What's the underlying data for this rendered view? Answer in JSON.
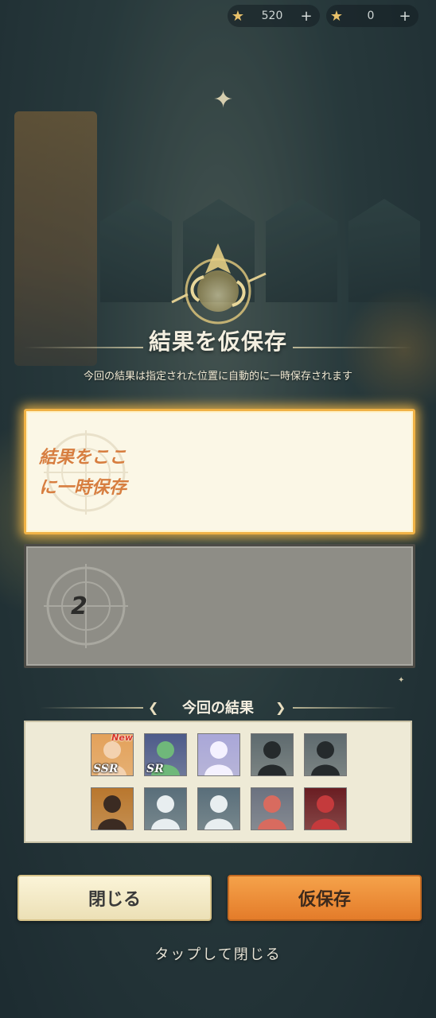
{
  "currency": [
    {
      "icon": "star-gem-icon",
      "value": "520",
      "plus": "+"
    },
    {
      "icon": "star-ticket-icon",
      "value": "0",
      "plus": "+"
    }
  ],
  "dialog": {
    "title": "結果を仮保存",
    "subtitle": "今回の結果は指定された位置に自動的に一時保存されます",
    "slot1_line1": "結果をここ",
    "slot1_line2": "に一時保存",
    "slot2_number": "2"
  },
  "results": {
    "heading": "今回の結果",
    "cards": [
      {
        "rarity": "SSR",
        "new": "New",
        "bg": "#e3a15a",
        "fig": "#f3d2b0"
      },
      {
        "rarity": "SR",
        "new": "",
        "bg": "#4d5b8a",
        "fig": "#6fb87a"
      },
      {
        "rarity": "",
        "new": "",
        "bg": "#a9a7d8",
        "fig": "#f4f1ff"
      },
      {
        "rarity": "",
        "new": "",
        "bg": "#5e6a6e",
        "fig": "#252a2c"
      },
      {
        "rarity": "",
        "new": "",
        "bg": "#5e6a6e",
        "fig": "#252a2c"
      },
      {
        "rarity": "",
        "new": "",
        "bg": "#b9772e",
        "fig": "#3b2b22"
      },
      {
        "rarity": "",
        "new": "",
        "bg": "#596e7a",
        "fig": "#e8eef0"
      },
      {
        "rarity": "",
        "new": "",
        "bg": "#596e7a",
        "fig": "#e8eef0"
      },
      {
        "rarity": "",
        "new": "",
        "bg": "#6b7280",
        "fig": "#d86b5f"
      },
      {
        "rarity": "",
        "new": "",
        "bg": "#6a1d22",
        "fig": "#c43a3c"
      }
    ]
  },
  "buttons": {
    "close": "閉じる",
    "save": "仮保存"
  },
  "footer": {
    "tap_close": "タップして閉じる"
  }
}
